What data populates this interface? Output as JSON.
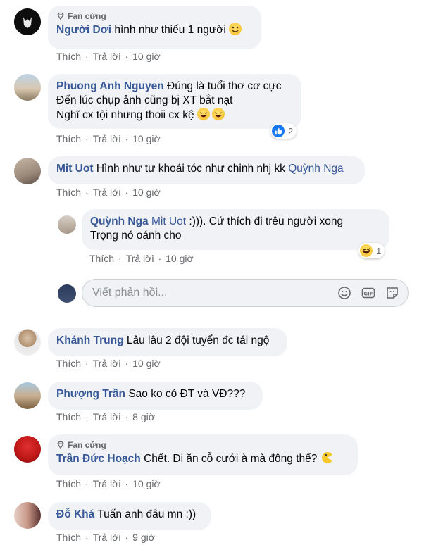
{
  "actions": {
    "like": "Thích",
    "reply": "Trả lời"
  },
  "badge": {
    "fan": "Fan cứng"
  },
  "comments": [
    {
      "author": "Người Dơi",
      "text": "hình như thiếu 1 người",
      "time": "10 giờ"
    },
    {
      "author": "Phuong Anh Nguyen",
      "lines": [
        "Đúng là tuổi thơ cơ cực",
        "Đến lúc chụp ảnh cũng bị XT bắt nạt",
        "Nghĩ cx tội nhưng thoii cx kệ"
      ],
      "time": "10 giờ",
      "reaction_count": "2"
    },
    {
      "author": "Mit Uot",
      "text": "Hình như tư khoái tóc như chinh nhj kk",
      "mention": "Quỳnh Nga",
      "time": "10 giờ"
    },
    {
      "author": "Quỳnh Nga",
      "mention": "Mit Uot",
      "lines": [
        ":))). Cứ thích đi trêu người xong",
        "Trọng nó oánh cho"
      ],
      "time": "10 giờ",
      "reaction_count": "1"
    },
    {
      "author": "Khánh Trung",
      "text": "Lâu lâu 2 đội tuyển đc tái ngộ",
      "time": "10 giờ"
    },
    {
      "author": "Phượng Trần",
      "text": "Sao ko có ĐT và VĐ???",
      "time": "8 giờ"
    },
    {
      "author": "Trần Đức Hoạch",
      "text": "Chết. Đi ăn cỗ cưới à mà đông thế?",
      "time": "10 giờ"
    },
    {
      "author": "Đỗ Khá",
      "text": "Tuấn anh đâu mn :))",
      "time": "9 giờ"
    }
  ],
  "reply_input": {
    "placeholder": "Viết phản hồi..."
  },
  "colors": {
    "author": "#385898",
    "muted": "#65676b",
    "bubble": "#f0f2f5",
    "like_blue": "#1877f2"
  }
}
